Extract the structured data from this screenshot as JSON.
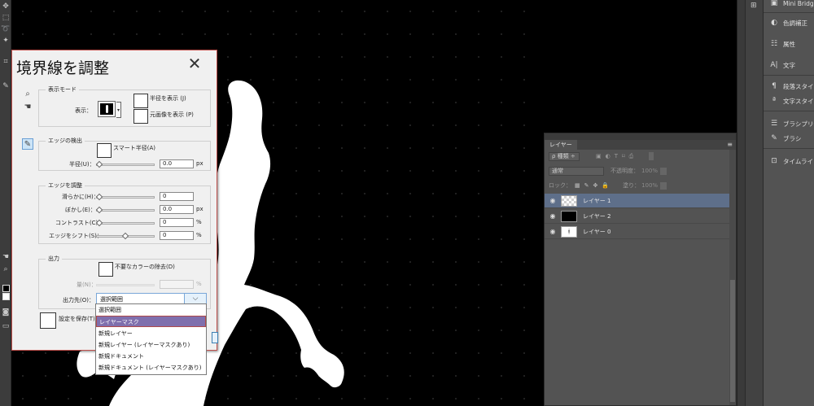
{
  "dialog": {
    "title": "境界線を調整",
    "close": "✕",
    "view_mode": {
      "group_title": "表示モード",
      "view_label": "表示：",
      "show_radius": "半径を表示 (J)",
      "show_original": "元画像を表示 (P)"
    },
    "edge_detection": {
      "group_title": "エッジの検出",
      "smart_radius": "スマート半径(A)",
      "radius_label": "半径(U)：",
      "radius_value": "0.0",
      "radius_unit": "px",
      "radius_level": 0
    },
    "adjust_edge": {
      "group_title": "エッジを調整",
      "smooth_label": "滑らかに(H)：",
      "smooth_value": "0",
      "smooth_level": 0,
      "feather_label": "ぼかし(E)：",
      "feather_value": "0.0",
      "feather_unit": "px",
      "feather_level": 0,
      "contrast_label": "コントラスト(C)：",
      "contrast_value": "0",
      "contrast_unit": "%",
      "contrast_level": 0,
      "shift_label": "エッジをシフト(S)：",
      "shift_value": "0",
      "shift_unit": "%",
      "shift_level": 0.5
    },
    "output": {
      "group_title": "出力",
      "decontaminate": "不要なカラーの除去(D)",
      "amount_label": "量(N)：",
      "amount_unit": "%",
      "output_to_label": "出力先(O)：",
      "output_to_value": "選択範囲"
    },
    "remember_settings": "設定を保存(T)"
  },
  "dropdown": {
    "options": [
      "選択範囲",
      "レイヤーマスク",
      "新規レイヤー",
      "新規レイヤー (レイヤーマスクあり)",
      "新規ドキュメント",
      "新規ドキュメント (レイヤーマスクあり)"
    ],
    "highlighted_index": 1
  },
  "layers_panel": {
    "tab": "レイヤー",
    "filter": "ρ 種類 ÷",
    "blend_mode": "通常",
    "opacity_label": "不透明度：",
    "opacity_value": "100%",
    "lock_label": "ロック：",
    "fill_label": "塗り：",
    "fill_value": "100%",
    "layers": [
      {
        "name": "レイヤー 1",
        "active": true
      },
      {
        "name": "レイヤー 2",
        "active": false
      },
      {
        "name": "レイヤー 0",
        "active": false
      }
    ]
  },
  "dock": {
    "items": [
      "Mini Bridge",
      "色調補正",
      "属性",
      "文字",
      "段落スタイル",
      "文字スタイル",
      "ブラシプリセット",
      "ブラシ",
      "タイムライン"
    ]
  },
  "colors": {
    "dialog_border": "#c0504d",
    "highlight": "#7f6fad",
    "active_layer": "#5e6f8a"
  }
}
